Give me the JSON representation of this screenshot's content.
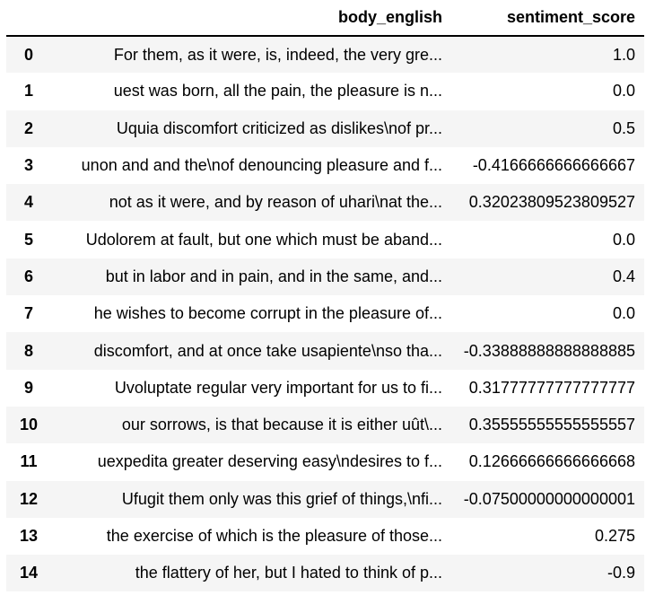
{
  "table": {
    "columns": [
      "",
      "body_english",
      "sentiment_score"
    ],
    "rows": [
      {
        "index": "0",
        "body_english": "For them, as it were, is, indeed, the very gre...",
        "sentiment_score": "1.0"
      },
      {
        "index": "1",
        "body_english": "uest was born, all the pain, the pleasure is n...",
        "sentiment_score": "0.0"
      },
      {
        "index": "2",
        "body_english": "Uquia discomfort criticized as dislikes\\nof pr...",
        "sentiment_score": "0.5"
      },
      {
        "index": "3",
        "body_english": "unon and and the\\nof denouncing pleasure and f...",
        "sentiment_score": "-0.4166666666666667"
      },
      {
        "index": "4",
        "body_english": "not as it were, and by reason of uhari\\nat the...",
        "sentiment_score": "0.32023809523809527"
      },
      {
        "index": "5",
        "body_english": "Udolorem at fault, but one which must be aband...",
        "sentiment_score": "0.0"
      },
      {
        "index": "6",
        "body_english": "but in labor and in pain, and in the same, and...",
        "sentiment_score": "0.4"
      },
      {
        "index": "7",
        "body_english": "he wishes to become corrupt in the pleasure of...",
        "sentiment_score": "0.0"
      },
      {
        "index": "8",
        "body_english": "discomfort, and at once take usapiente\\nso tha...",
        "sentiment_score": "-0.33888888888888885"
      },
      {
        "index": "9",
        "body_english": "Uvoluptate regular very important for us to fi...",
        "sentiment_score": "0.31777777777777777"
      },
      {
        "index": "10",
        "body_english": "our sorrows, is that because it is either uût\\...",
        "sentiment_score": "0.35555555555555557"
      },
      {
        "index": "11",
        "body_english": "uexpedita greater deserving easy\\ndesires to f...",
        "sentiment_score": "0.12666666666666668"
      },
      {
        "index": "12",
        "body_english": "Ufugit them only was this grief of things,\\nfi...",
        "sentiment_score": "-0.07500000000000001"
      },
      {
        "index": "13",
        "body_english": "the exercise of which is the pleasure of those...",
        "sentiment_score": "0.275"
      },
      {
        "index": "14",
        "body_english": "the flattery of her, but I hated to think of p...",
        "sentiment_score": "-0.9"
      }
    ]
  }
}
